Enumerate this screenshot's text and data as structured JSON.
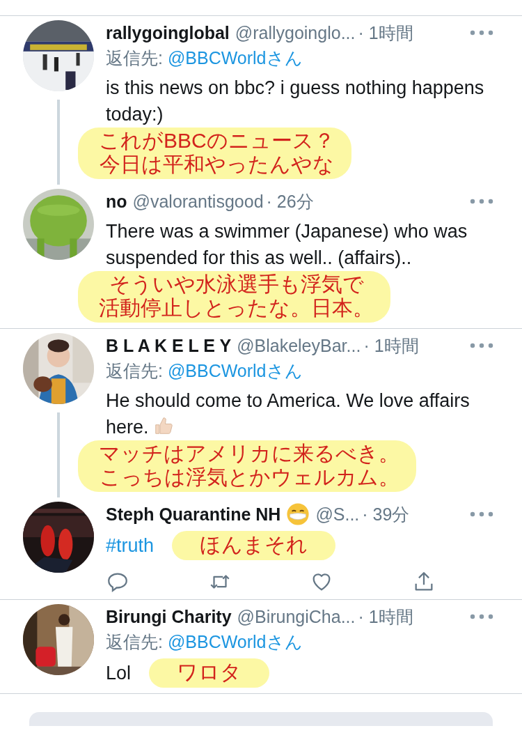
{
  "tweets": [
    {
      "name": "rallygoinglobal",
      "handle": "@rallygoinglo...",
      "time": "· 1時間",
      "reply_prefix": "返信先:",
      "reply_to": "@BBCWorldさん",
      "text": "is this news on bbc? i guess nothing happens today:)",
      "hashtag": false,
      "annotation": {
        "kind": "block",
        "lines": [
          "これがBBCのニュース？",
          "今日は平和やったんやな"
        ]
      },
      "actions": false,
      "thread_line": true
    },
    {
      "name": "no",
      "handle": "@valorantisgood",
      "time": "· 26分",
      "text": "There was a swimmer (Japanese) who was suspended for this as well.. (affairs)..",
      "hashtag": false,
      "annotation": {
        "kind": "block",
        "lines": [
          "そういや水泳選手も浮気で",
          "活動停止しとったな。日本。"
        ]
      },
      "actions": false,
      "thread_line": false
    },
    {
      "name": "B L A K E L E Y",
      "handle": "@BlakeleyBar...",
      "time": "· 1時間",
      "reply_prefix": "返信先:",
      "reply_to": "@BBCWorldさん",
      "text": "He should come to America. We love affairs here.",
      "hashtag": false,
      "thumbs_up_emoji": true,
      "annotation": {
        "kind": "block",
        "lines": [
          "マッチはアメリカに来るべき。",
          "こっちは浮気とかウェルカム。"
        ]
      },
      "actions": false,
      "thread_line": true
    },
    {
      "name": "Steph Quarantine NH",
      "mask_emoji": true,
      "handle": "@S...",
      "time": "· 39分",
      "text": "#truth",
      "hashtag": true,
      "annotation": {
        "kind": "inline",
        "lines": [
          "ほんまそれ"
        ]
      },
      "actions": true,
      "thread_line": false
    },
    {
      "name": "Birungi Charity",
      "handle": "@BirungiCha...",
      "time": "· 1時間",
      "reply_prefix": "返信先:",
      "reply_to": "@BBCWorldさん",
      "text": "Lol",
      "hashtag": false,
      "annotation": {
        "kind": "inline",
        "lines": [
          "ワロタ"
        ]
      },
      "actions": false,
      "thread_line": false
    }
  ]
}
